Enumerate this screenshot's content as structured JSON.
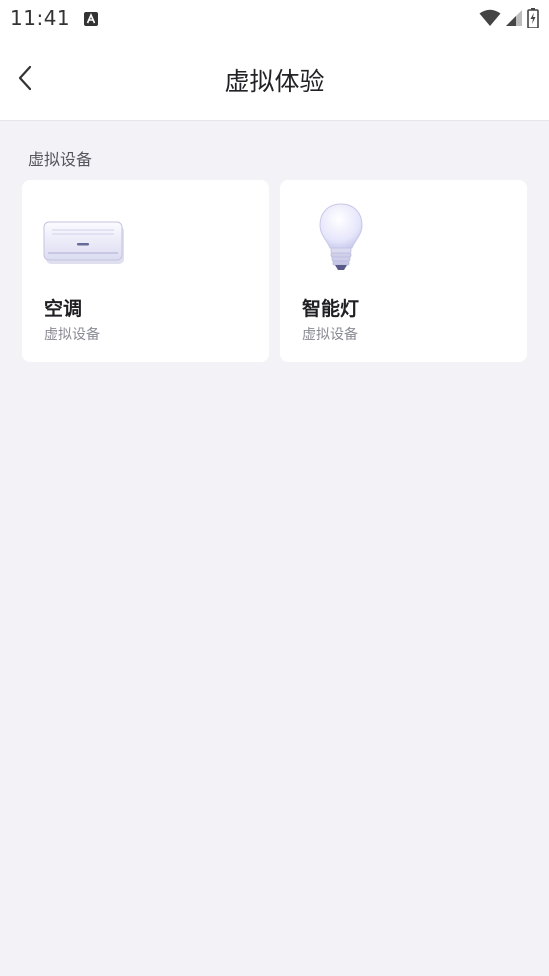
{
  "status_bar": {
    "time": "11:41",
    "icons": [
      "notification-a-icon",
      "wifi-icon",
      "signal-icon",
      "battery-charging-icon"
    ]
  },
  "header": {
    "title": "虚拟体验",
    "back_icon": "chevron-left-icon"
  },
  "section": {
    "label": "虚拟设备"
  },
  "devices": [
    {
      "name": "空调",
      "subtitle": "虚拟设备",
      "icon": "air-conditioner-icon"
    },
    {
      "name": "智能灯",
      "subtitle": "虚拟设备",
      "icon": "light-bulb-icon"
    }
  ],
  "colors": {
    "background": "#f2f2f7",
    "card": "#ffffff",
    "title_text": "#222226",
    "subtitle_text": "#8a8a94"
  }
}
